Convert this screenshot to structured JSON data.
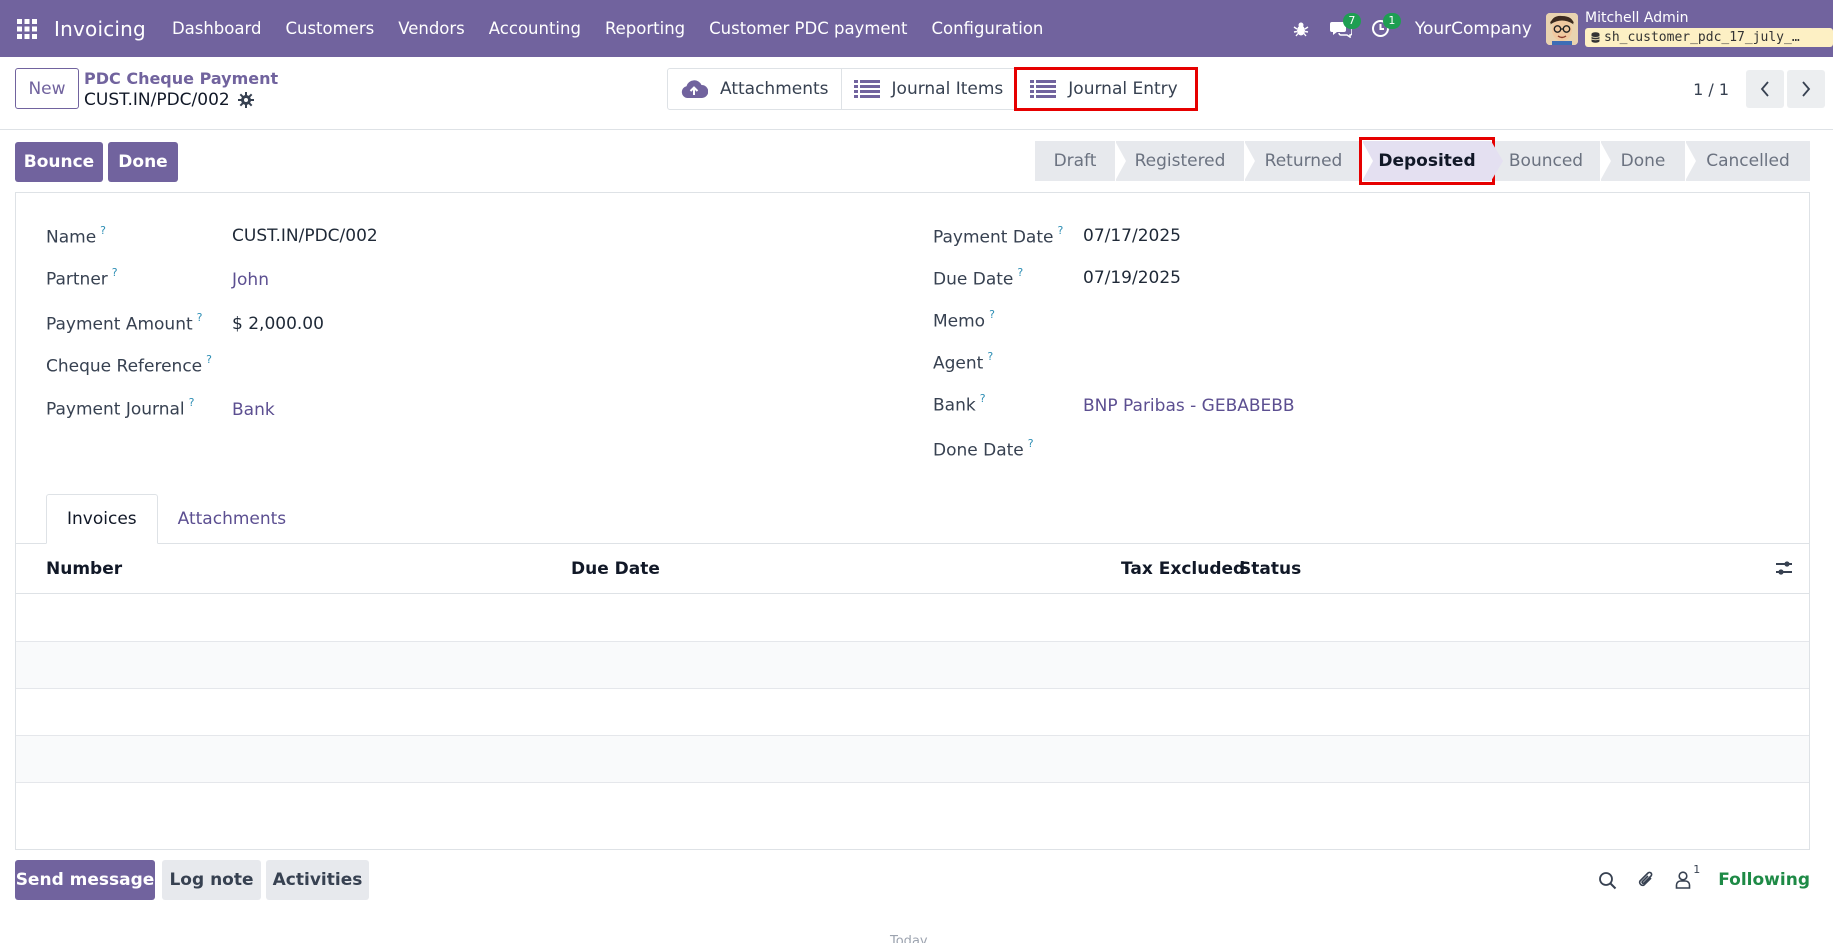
{
  "navbar": {
    "app_name": "Invoicing",
    "menu": [
      "Dashboard",
      "Customers",
      "Vendors",
      "Accounting",
      "Reporting",
      "Customer PDC payment",
      "Configuration"
    ],
    "messages_count": "7",
    "activities_count": "1",
    "company": "YourCompany",
    "user_name": "Mitchell Admin",
    "database": "sh_customer_pdc_17_july_…"
  },
  "control": {
    "new_label": "New",
    "breadcrumb": "PDC Cheque Payment",
    "record_name": "CUST.IN/PDC/002",
    "smart_buttons": {
      "attachments": "Attachments",
      "journal_items": "Journal Items",
      "journal_entry": "Journal Entry"
    },
    "pager": "1 / 1"
  },
  "statusbar": {
    "actions": {
      "bounce": "Bounce",
      "done": "Done"
    },
    "stages": [
      "Draft",
      "Registered",
      "Returned",
      "Deposited",
      "Bounced",
      "Done",
      "Cancelled"
    ],
    "active_stage": "Deposited"
  },
  "form": {
    "left": {
      "name_label": "Name",
      "name_value": "CUST.IN/PDC/002",
      "partner_label": "Partner",
      "partner_value": "John",
      "amount_label": "Payment Amount",
      "amount_value": "$ 2,000.00",
      "cheque_label": "Cheque Reference",
      "journal_label": "Payment Journal",
      "journal_value": "Bank"
    },
    "right": {
      "payment_date_label": "Payment Date",
      "payment_date_value": "07/17/2025",
      "due_date_label": "Due Date",
      "due_date_value": "07/19/2025",
      "memo_label": "Memo",
      "agent_label": "Agent",
      "bank_label": "Bank",
      "bank_value": "BNP Paribas - GEBABEBB",
      "done_date_label": "Done Date"
    },
    "help_marker": "?"
  },
  "tabs": {
    "invoices": "Invoices",
    "attachments": "Attachments"
  },
  "table": {
    "columns": [
      "Number",
      "Due Date",
      "Tax Excluded",
      "Status"
    ]
  },
  "chatter": {
    "send_message": "Send message",
    "log_note": "Log note",
    "activities": "Activities",
    "followers_count": "1",
    "following": "Following"
  },
  "footer_cut": "Today",
  "colors": {
    "brand": "#71639e",
    "highlight": "#e60000",
    "following": "#1e8a46",
    "badge": "#1e9e52"
  },
  "icons": [
    "apps-grid-icon",
    "bug-icon",
    "chat-icon",
    "clock-icon",
    "gear-icon",
    "cloud-upload-icon",
    "list-icon",
    "chevron-left-icon",
    "chevron-right-icon",
    "column-settings-icon",
    "search-icon",
    "paperclip-icon",
    "user-icon",
    "database-icon"
  ]
}
